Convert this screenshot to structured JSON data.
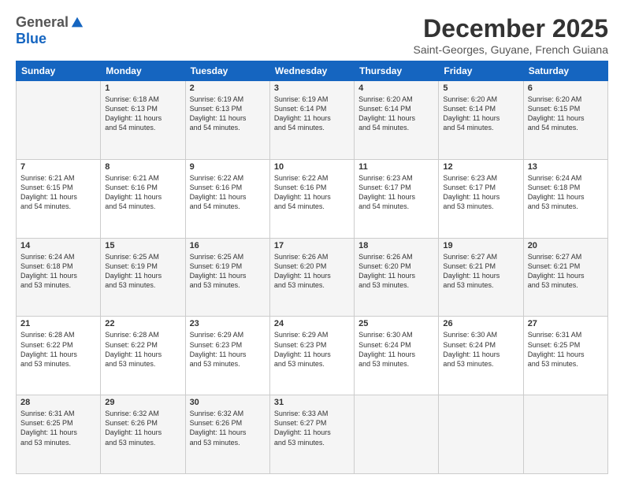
{
  "logo": {
    "general": "General",
    "blue": "Blue"
  },
  "title": "December 2025",
  "subtitle": "Saint-Georges, Guyane, French Guiana",
  "headers": [
    "Sunday",
    "Monday",
    "Tuesday",
    "Wednesday",
    "Thursday",
    "Friday",
    "Saturday"
  ],
  "weeks": [
    [
      {
        "day": "",
        "info": ""
      },
      {
        "day": "1",
        "info": "Sunrise: 6:18 AM\nSunset: 6:13 PM\nDaylight: 11 hours\nand 54 minutes."
      },
      {
        "day": "2",
        "info": "Sunrise: 6:19 AM\nSunset: 6:13 PM\nDaylight: 11 hours\nand 54 minutes."
      },
      {
        "day": "3",
        "info": "Sunrise: 6:19 AM\nSunset: 6:14 PM\nDaylight: 11 hours\nand 54 minutes."
      },
      {
        "day": "4",
        "info": "Sunrise: 6:20 AM\nSunset: 6:14 PM\nDaylight: 11 hours\nand 54 minutes."
      },
      {
        "day": "5",
        "info": "Sunrise: 6:20 AM\nSunset: 6:14 PM\nDaylight: 11 hours\nand 54 minutes."
      },
      {
        "day": "6",
        "info": "Sunrise: 6:20 AM\nSunset: 6:15 PM\nDaylight: 11 hours\nand 54 minutes."
      }
    ],
    [
      {
        "day": "7",
        "info": "Sunrise: 6:21 AM\nSunset: 6:15 PM\nDaylight: 11 hours\nand 54 minutes."
      },
      {
        "day": "8",
        "info": "Sunrise: 6:21 AM\nSunset: 6:16 PM\nDaylight: 11 hours\nand 54 minutes."
      },
      {
        "day": "9",
        "info": "Sunrise: 6:22 AM\nSunset: 6:16 PM\nDaylight: 11 hours\nand 54 minutes."
      },
      {
        "day": "10",
        "info": "Sunrise: 6:22 AM\nSunset: 6:16 PM\nDaylight: 11 hours\nand 54 minutes."
      },
      {
        "day": "11",
        "info": "Sunrise: 6:23 AM\nSunset: 6:17 PM\nDaylight: 11 hours\nand 54 minutes."
      },
      {
        "day": "12",
        "info": "Sunrise: 6:23 AM\nSunset: 6:17 PM\nDaylight: 11 hours\nand 53 minutes."
      },
      {
        "day": "13",
        "info": "Sunrise: 6:24 AM\nSunset: 6:18 PM\nDaylight: 11 hours\nand 53 minutes."
      }
    ],
    [
      {
        "day": "14",
        "info": "Sunrise: 6:24 AM\nSunset: 6:18 PM\nDaylight: 11 hours\nand 53 minutes."
      },
      {
        "day": "15",
        "info": "Sunrise: 6:25 AM\nSunset: 6:19 PM\nDaylight: 11 hours\nand 53 minutes."
      },
      {
        "day": "16",
        "info": "Sunrise: 6:25 AM\nSunset: 6:19 PM\nDaylight: 11 hours\nand 53 minutes."
      },
      {
        "day": "17",
        "info": "Sunrise: 6:26 AM\nSunset: 6:20 PM\nDaylight: 11 hours\nand 53 minutes."
      },
      {
        "day": "18",
        "info": "Sunrise: 6:26 AM\nSunset: 6:20 PM\nDaylight: 11 hours\nand 53 minutes."
      },
      {
        "day": "19",
        "info": "Sunrise: 6:27 AM\nSunset: 6:21 PM\nDaylight: 11 hours\nand 53 minutes."
      },
      {
        "day": "20",
        "info": "Sunrise: 6:27 AM\nSunset: 6:21 PM\nDaylight: 11 hours\nand 53 minutes."
      }
    ],
    [
      {
        "day": "21",
        "info": "Sunrise: 6:28 AM\nSunset: 6:22 PM\nDaylight: 11 hours\nand 53 minutes."
      },
      {
        "day": "22",
        "info": "Sunrise: 6:28 AM\nSunset: 6:22 PM\nDaylight: 11 hours\nand 53 minutes."
      },
      {
        "day": "23",
        "info": "Sunrise: 6:29 AM\nSunset: 6:23 PM\nDaylight: 11 hours\nand 53 minutes."
      },
      {
        "day": "24",
        "info": "Sunrise: 6:29 AM\nSunset: 6:23 PM\nDaylight: 11 hours\nand 53 minutes."
      },
      {
        "day": "25",
        "info": "Sunrise: 6:30 AM\nSunset: 6:24 PM\nDaylight: 11 hours\nand 53 minutes."
      },
      {
        "day": "26",
        "info": "Sunrise: 6:30 AM\nSunset: 6:24 PM\nDaylight: 11 hours\nand 53 minutes."
      },
      {
        "day": "27",
        "info": "Sunrise: 6:31 AM\nSunset: 6:25 PM\nDaylight: 11 hours\nand 53 minutes."
      }
    ],
    [
      {
        "day": "28",
        "info": "Sunrise: 6:31 AM\nSunset: 6:25 PM\nDaylight: 11 hours\nand 53 minutes."
      },
      {
        "day": "29",
        "info": "Sunrise: 6:32 AM\nSunset: 6:26 PM\nDaylight: 11 hours\nand 53 minutes."
      },
      {
        "day": "30",
        "info": "Sunrise: 6:32 AM\nSunset: 6:26 PM\nDaylight: 11 hours\nand 53 minutes."
      },
      {
        "day": "31",
        "info": "Sunrise: 6:33 AM\nSunset: 6:27 PM\nDaylight: 11 hours\nand 53 minutes."
      },
      {
        "day": "",
        "info": ""
      },
      {
        "day": "",
        "info": ""
      },
      {
        "day": "",
        "info": ""
      }
    ]
  ]
}
